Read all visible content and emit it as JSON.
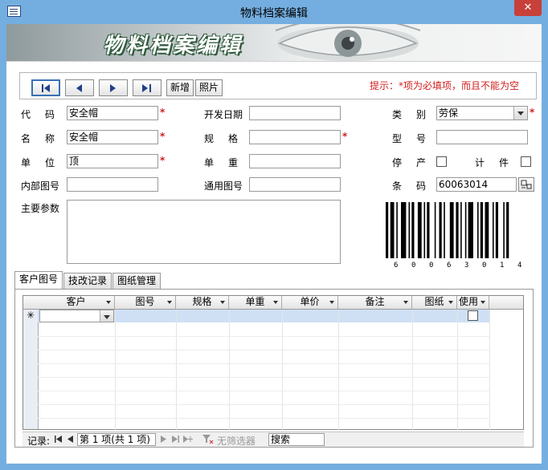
{
  "window": {
    "title": "物料档案编辑",
    "close": "✕"
  },
  "banner": {
    "title": "物料档案编辑"
  },
  "toolbar": {
    "new_label": "新增",
    "photo_label": "照片"
  },
  "hint": "提示：*项为必填项，而且不能为空",
  "required_mark": "*",
  "form": {
    "code_label": "代码",
    "code_value": "安全帽",
    "name_label": "名称",
    "name_value": "安全帽",
    "unit_label": "单位",
    "unit_value": "顶",
    "inner_no_label": "内部图号",
    "inner_no_value": "",
    "main_params_label": "主要参数",
    "dev_date_label": "开发日期",
    "dev_date_value": "",
    "spec_label": "规格",
    "spec_value": "",
    "weight_label": "单重",
    "weight_value": "",
    "common_no_label": "通用图号",
    "common_no_value": "",
    "category_label": "类别",
    "category_value": "劳保",
    "model_label": "型号",
    "model_value": "",
    "stop_label": "停产",
    "stop_checked": false,
    "count_label": "计件",
    "count_checked": false,
    "barcode_label": "条码",
    "barcode_value": "60063014"
  },
  "barcode_digits": [
    "6",
    "0",
    "0",
    "6",
    "3",
    "0",
    "1",
    "4"
  ],
  "tabs": [
    {
      "label": "客户图号",
      "active": true
    },
    {
      "label": "技改记录",
      "active": false
    },
    {
      "label": "图纸管理",
      "active": false
    }
  ],
  "grid": {
    "columns": [
      "客户",
      "图号",
      "规格",
      "单重",
      "单价",
      "备注",
      "图纸",
      "使用"
    ],
    "new_row_marker": "✳"
  },
  "navbar": {
    "record_label": "记录:",
    "record_value": "第 1 项(共 1 项)",
    "filter_label": "无筛选器",
    "search_value": "搜索"
  },
  "colors": {
    "window_border": "#74aee0",
    "required": "#d0201e",
    "close": "#c7403a",
    "grid_new_row": "#cfe0f5"
  }
}
